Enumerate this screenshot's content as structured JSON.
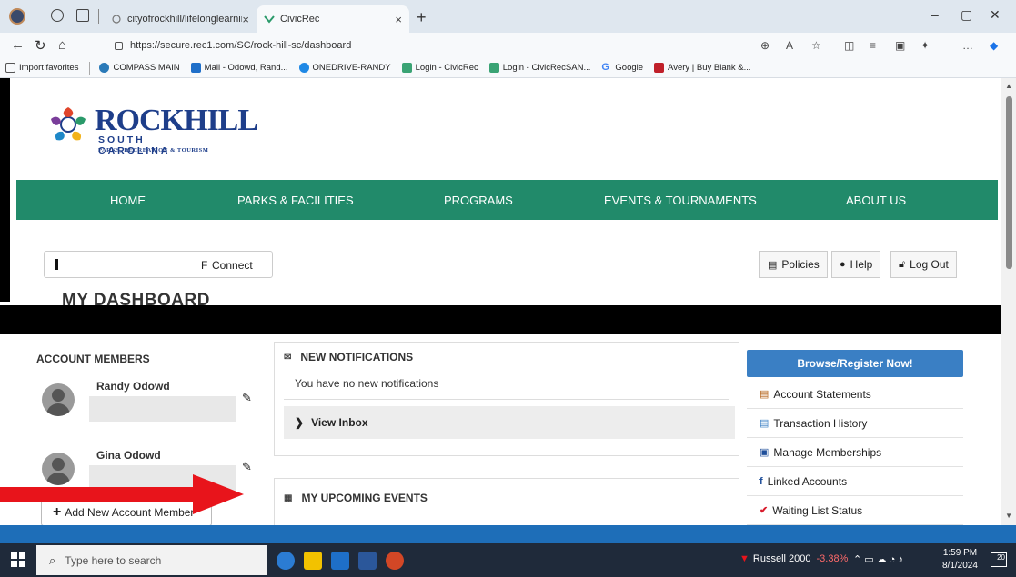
{
  "browser": {
    "tabs": [
      {
        "title": "cityofrockhill/lifelonglearning - S",
        "close": "×"
      },
      {
        "title": "CivicRec",
        "close": "×"
      }
    ],
    "new_tab": "+",
    "url": "https://secure.rec1.com/SC/rock-hill-sc/dashboard",
    "favorites": [
      "Import favorites",
      "COMPASS MAIN",
      "Mail - Odowd, Rand...",
      "ONEDRIVE-RANDY",
      "Login - CivicRec",
      "Login - CivicRecSAN...",
      "Google",
      "Avery | Buy Blank &..."
    ]
  },
  "logo": {
    "title": "ROCKHILL",
    "subtitle": "SOUTH CAROLINA",
    "tagline": "PARKS, RECREATION & TOURISM"
  },
  "nav": [
    "HOME",
    "PARKS & FACILITIES",
    "PROGRAMS",
    "EVENTS & TOURNAMENTS",
    "ABOUT US"
  ],
  "connect": {
    "label": "Connect",
    "prefix": "F"
  },
  "header_buttons": {
    "policies": "Policies",
    "help": "Help",
    "logout": "Log Out"
  },
  "dashboard_title": "MY DASHBOARD",
  "account_members": {
    "heading": "ACCOUNT MEMBERS",
    "members": [
      "Randy Odowd",
      "Gina Odowd"
    ],
    "add_label": "Add New Account Member"
  },
  "notifications": {
    "heading": "NEW NOTIFICATIONS",
    "empty_text": "You have no new notifications",
    "inbox_label": "View Inbox"
  },
  "events": {
    "heading": "MY UPCOMING EVENTS"
  },
  "sidebar": {
    "browse_label": "Browse/Register Now!",
    "links": [
      "Account Statements",
      "Transaction History",
      "Manage Memberships",
      "Linked Accounts",
      "Waiting List Status"
    ]
  },
  "taskbar": {
    "search_placeholder": "Type here to search",
    "ticker_name": "Russell 2000",
    "ticker_change": "-3.38%",
    "time": "1:59 PM",
    "date": "8/1/2024",
    "notif_count": "20"
  },
  "colors": {
    "nav_green": "#218a6a",
    "browse_blue": "#3a7fc4",
    "arrow_red": "#e8141b"
  }
}
